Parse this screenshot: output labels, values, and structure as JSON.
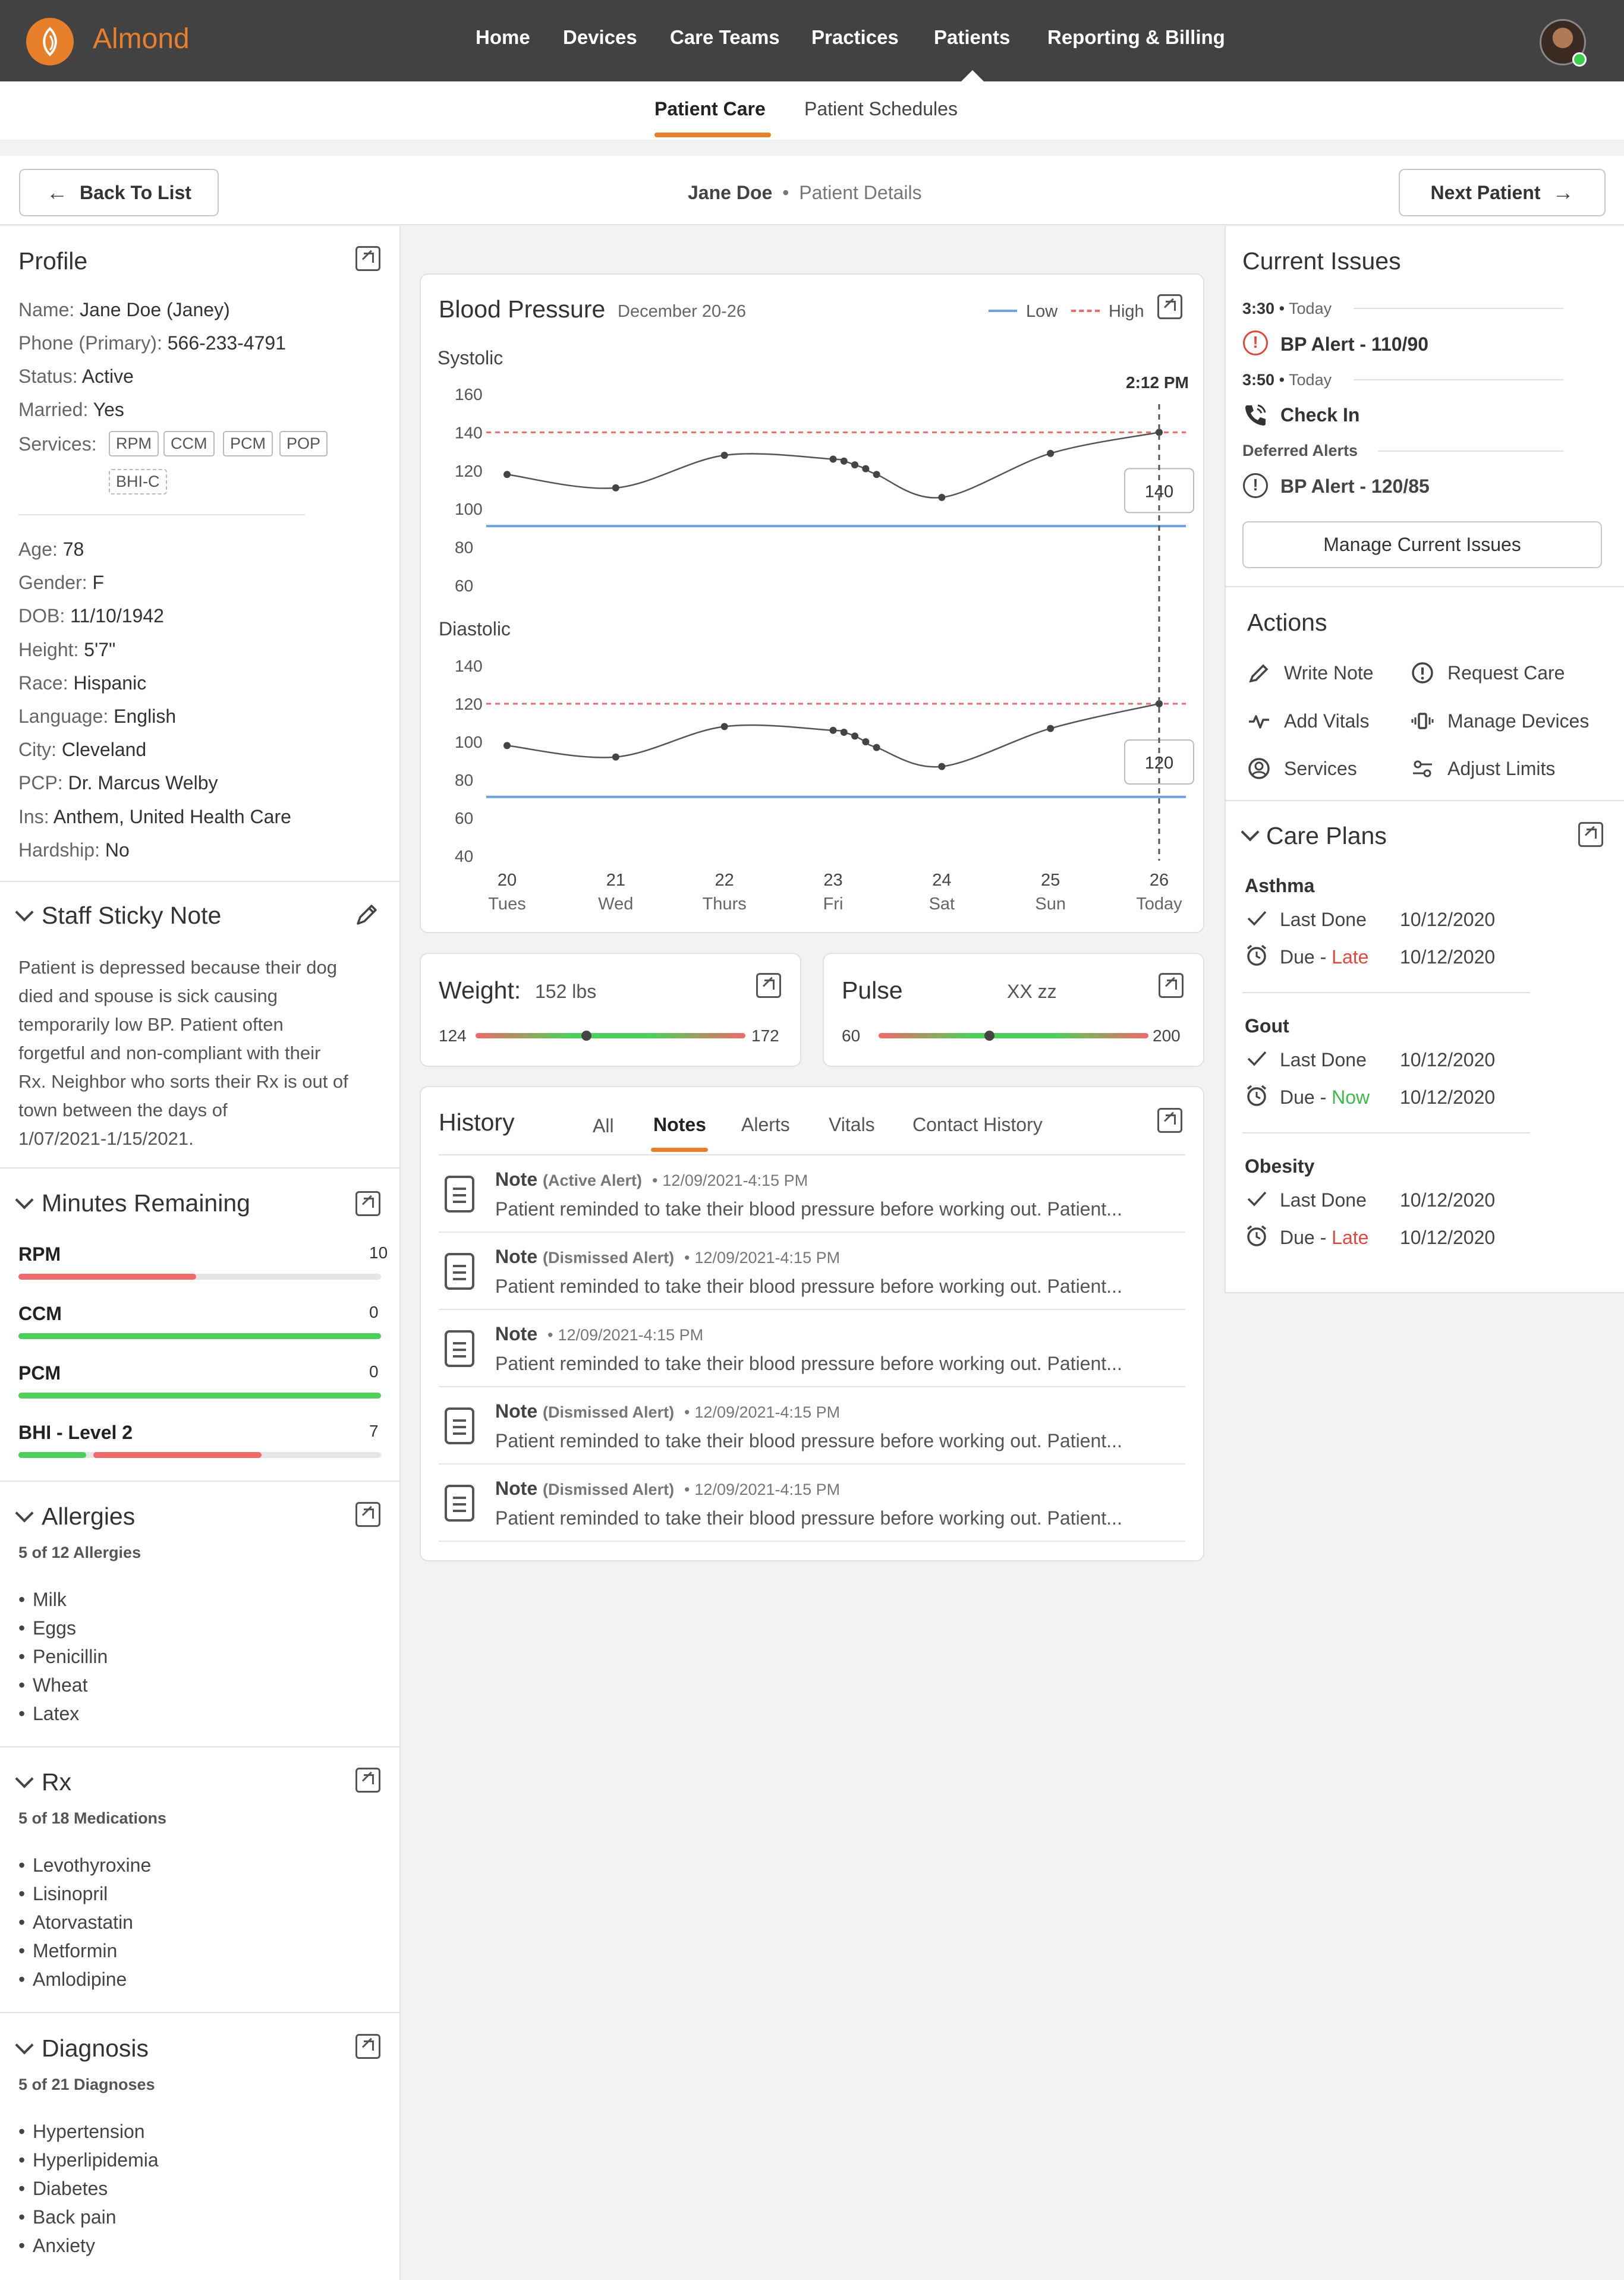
{
  "app": {
    "name": "Almond",
    "brand_color": "#e8802b"
  },
  "nav": {
    "items": [
      "Home",
      "Devices",
      "Care Teams",
      "Practices",
      "Patients",
      "Reporting & Billing"
    ],
    "active": "Patients"
  },
  "subnav": {
    "tabs": [
      "Patient Care",
      "Patient Schedules"
    ],
    "active": "Patient Care"
  },
  "header": {
    "back_label": "Back To List",
    "patient_name": "Jane Doe",
    "bullet": "•",
    "page_title": "Patient Details",
    "next_label": "Next Patient"
  },
  "profile": {
    "title": "Profile",
    "fields1": [
      {
        "label": "Name:",
        "value": "Jane Doe (Janey)"
      },
      {
        "label": "Phone (Primary):",
        "value": "566-233-4791"
      },
      {
        "label": "Status:",
        "value": "Active"
      },
      {
        "label": "Married:",
        "value": "Yes"
      }
    ],
    "services_label": "Services:",
    "services": [
      "RPM",
      "CCM",
      "PCM",
      "POP",
      "BHI-C"
    ],
    "fields2": [
      {
        "label": "Age:",
        "value": "78"
      },
      {
        "label": "Gender:",
        "value": "F"
      },
      {
        "label": "DOB:",
        "value": "11/10/1942"
      },
      {
        "label": "Height:",
        "value": "5'7\""
      },
      {
        "label": "Race:",
        "value": "Hispanic"
      },
      {
        "label": "Language:",
        "value": "English"
      },
      {
        "label": "City:",
        "value": "Cleveland"
      },
      {
        "label": "PCP:",
        "value": "Dr. Marcus Welby"
      },
      {
        "label": "Ins:",
        "value": "Anthem, United Health Care"
      },
      {
        "label": "Hardship:",
        "value": "No"
      }
    ]
  },
  "sticky": {
    "title": "Staff Sticky Note",
    "lines": [
      "Patient is depressed because their dog",
      "died and spouse is sick causing",
      "temporarily low BP. Patient often",
      "forgetful and non-compliant with their",
      "Rx. Neighbor who sorts their Rx is out of",
      "town between the days of",
      "1/07/2021-1/15/2021."
    ]
  },
  "minutes": {
    "title": "Minutes Remaining",
    "items": [
      {
        "name": "RPM",
        "value": "10",
        "fraction": 0.49,
        "color": "#ef6a6a"
      },
      {
        "name": "CCM",
        "value": "0",
        "fraction": 1.0,
        "color": "#4cd05a"
      },
      {
        "name": "PCM",
        "value": "0",
        "fraction": 1.0,
        "color": "#4cd05a"
      },
      {
        "name": "BHI - Level 2",
        "value": "7",
        "fraction": 0.2,
        "fraction2": 0.47,
        "color": "#4cd05a",
        "color2": "#ef6a6a"
      }
    ]
  },
  "allergies": {
    "title": "Allergies",
    "count": "5 of 12 Allergies",
    "items": [
      "Milk",
      "Eggs",
      "Penicillin",
      "Wheat",
      "Latex"
    ]
  },
  "rx": {
    "title": "Rx",
    "count": "5 of 18 Medications",
    "items": [
      "Levothyroxine",
      "Lisinopril",
      "Atorvastatin",
      "Metformin",
      "Amlodipine"
    ]
  },
  "diagnosis": {
    "title": "Diagnosis",
    "count": "5 of 21 Diagnoses",
    "items": [
      "Hypertension",
      "Hyperlipidemia",
      "Diabetes",
      "Back pain",
      "Anxiety"
    ]
  },
  "bp": {
    "title": "Blood Pressure",
    "range": "December 20-26",
    "legend": [
      {
        "name": "Low",
        "color": "#6aa3e8"
      },
      {
        "name": "High",
        "color": "#ef6a6a"
      }
    ],
    "cursor_time": "2:12 PM",
    "x_days": [
      {
        "day": "20",
        "label": "Tues"
      },
      {
        "day": "21",
        "label": "Wed"
      },
      {
        "day": "22",
        "label": "Thurs"
      },
      {
        "day": "23",
        "label": "Fri"
      },
      {
        "day": "24",
        "label": "Sat"
      },
      {
        "day": "25",
        "label": "Sun"
      },
      {
        "day": "26",
        "label": "Today"
      }
    ]
  },
  "chart_data": [
    {
      "type": "line",
      "title": "Systolic",
      "ylim": [
        60,
        160
      ],
      "yticks": [
        "160",
        "140",
        "120",
        "100",
        "80",
        "60"
      ],
      "x": [
        20.0,
        21.0,
        22.0,
        23.0,
        23.1,
        23.2,
        23.3,
        23.4,
        24.0,
        25.0,
        26.0
      ],
      "values": [
        118,
        111,
        128,
        126,
        125,
        123,
        121,
        118,
        106,
        129,
        140
      ],
      "high": 140,
      "low": 91,
      "tooltip": "140"
    },
    {
      "type": "line",
      "title": "Diastolic",
      "ylim": [
        40,
        140
      ],
      "yticks": [
        "140",
        "120",
        "100",
        "80",
        "60",
        "40"
      ],
      "x": [
        20.0,
        21.0,
        22.0,
        23.0,
        23.1,
        23.2,
        23.3,
        23.4,
        24.0,
        25.0,
        26.0
      ],
      "values": [
        98,
        92,
        108,
        106,
        105,
        103,
        100,
        97,
        87,
        107,
        120
      ],
      "high": 120,
      "low": 71,
      "tooltip": "120"
    }
  ],
  "weight": {
    "title": "Weight:",
    "value": "152 lbs",
    "min": "124",
    "max": "172",
    "fraction": 0.41
  },
  "pulse": {
    "title": "Pulse",
    "value": "XX zz",
    "min": "60",
    "max": "200",
    "fraction": 0.41
  },
  "history": {
    "title": "History",
    "tabs": [
      "All",
      "Notes",
      "Alerts",
      "Vitals",
      "Contact History"
    ],
    "active": "Notes",
    "items": [
      {
        "type": "Note",
        "status": "(Active Alert)",
        "date": "12/09/2021-4:15 PM",
        "text": "Patient reminded to take their blood pressure before working out. Patient..."
      },
      {
        "type": "Note",
        "status": "(Dismissed Alert)",
        "date": "12/09/2021-4:15 PM",
        "text": "Patient reminded to take their blood pressure before working out. Patient..."
      },
      {
        "type": "Note",
        "status": "",
        "date": "12/09/2021-4:15 PM",
        "text": "Patient reminded to take their blood pressure before working out. Patient..."
      },
      {
        "type": "Note",
        "status": "(Dismissed Alert)",
        "date": "12/09/2021-4:15 PM",
        "text": "Patient reminded to take their blood pressure before working out. Patient..."
      },
      {
        "type": "Note",
        "status": "(Dismissed Alert)",
        "date": "12/09/2021-4:15 PM",
        "text": "Patient reminded to take their blood pressure before working out. Patient..."
      }
    ]
  },
  "issues": {
    "title": "Current Issues",
    "groups": [
      {
        "time": "3:30",
        "when": "Today",
        "label": "BP Alert - 110/90",
        "icon": "alert-icon",
        "color": "#e0483e"
      },
      {
        "time": "3:50",
        "when": "Today",
        "label": "Check In",
        "icon": "phone-icon",
        "color": "#333333"
      }
    ],
    "deferred_title": "Deferred Alerts",
    "deferred": [
      {
        "label": "BP Alert - 120/85",
        "icon": "alert-icon"
      }
    ],
    "manage_label": "Manage Current Issues"
  },
  "actions": {
    "title": "Actions",
    "items": [
      {
        "label": "Write Note",
        "icon": "pencil-icon"
      },
      {
        "label": "Request Care",
        "icon": "alert-circle-icon"
      },
      {
        "label": "Add Vitals",
        "icon": "pulse-icon"
      },
      {
        "label": "Manage Devices",
        "icon": "device-icon"
      },
      {
        "label": "Services",
        "icon": "user-circle-icon"
      },
      {
        "label": "Adjust Limits",
        "icon": "sliders-icon"
      }
    ]
  },
  "care_plans": {
    "title": "Care Plans",
    "last_done_label": "Last Done",
    "due_label": "Due -",
    "plans": [
      {
        "name": "Asthma",
        "last_done": "10/12/2020",
        "due_status": "Late",
        "due_color": "#e0483e",
        "due_date": "10/12/2020"
      },
      {
        "name": "Gout",
        "last_done": "10/12/2020",
        "due_status": "Now",
        "due_color": "#3cbb4a",
        "due_date": "10/12/2020"
      },
      {
        "name": "Obesity",
        "last_done": "10/12/2020",
        "due_status": "Late",
        "due_color": "#e0483e",
        "due_date": "10/12/2020"
      }
    ]
  }
}
